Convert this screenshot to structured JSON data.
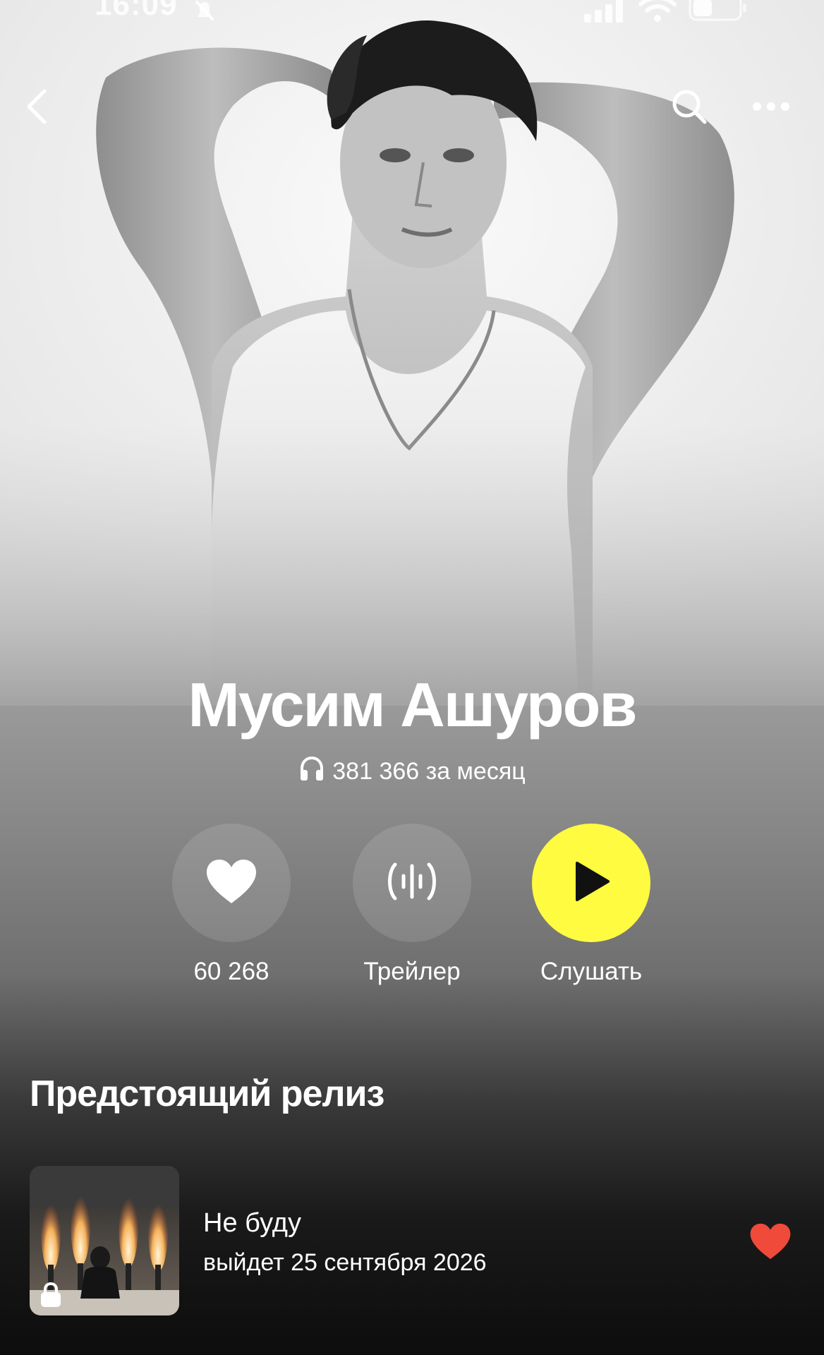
{
  "status_bar": {
    "time": "16:09"
  },
  "icons": {
    "back": "chevron-left-icon",
    "search": "search-icon",
    "more": "more-dots-icon",
    "headphones": "headphones-icon",
    "like": "heart-icon",
    "trailer": "waveform-icon",
    "play": "play-icon",
    "lock": "lock-icon"
  },
  "artist": {
    "name": "Мусим Ашуров",
    "listeners": "381 366 за месяц"
  },
  "actions": {
    "like_count": "60 268",
    "trailer_label": "Трейлер",
    "listen_label": "Слушать"
  },
  "upcoming": {
    "section_title": "Предстоящий релиз",
    "title": "Не буду",
    "date": "выйдет 25 сентября 2026"
  },
  "colors": {
    "accent_yellow": "#fefb41",
    "like_red": "#f04a3a"
  }
}
